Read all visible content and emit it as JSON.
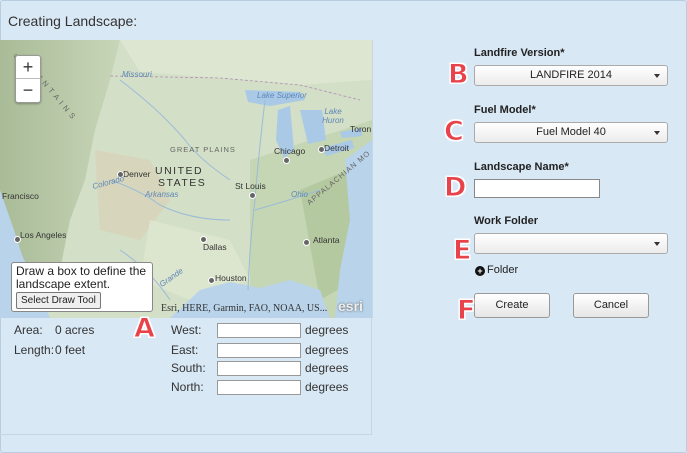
{
  "title": "Creating Landscape:",
  "map": {
    "zoom_in": "+",
    "zoom_out": "−",
    "labels": {
      "mountains": "M O U N T A I N S",
      "missouri": "Missouri",
      "lake_superior": "Lake Superior",
      "lake_huron": "Lake Huron",
      "toronto": "Toron",
      "great_plains": "GREAT PLAINS",
      "chicago": "Chicago",
      "detroit": "Detroit",
      "united": "UNITED",
      "states": "STATES",
      "denver": "Denver",
      "colorado": "Colorado",
      "arkansas": "Arkansas",
      "st_louis": "St Louis",
      "ohio": "Ohio",
      "appalachian": "APPALACHIAN MO",
      "francisco": "Francisco",
      "los_angeles": "Los Angeles",
      "dallas": "Dallas",
      "atlanta": "Atlanta",
      "houston": "Houston",
      "grande": "Grande",
      "nebraska_frag": "S"
    },
    "draw_instructions": "Draw a box to define the landscape extent.",
    "draw_button": "Select Draw Tool",
    "attribution": "Esri, HERE, Garmin, FAO, NOAA, US...",
    "logo": "esri"
  },
  "stats": {
    "area_label": "Area:",
    "area_value": "0 acres",
    "length_label": "Length:",
    "length_value": "0 feet"
  },
  "coords": {
    "west": "West:",
    "east": "East:",
    "south": "South:",
    "north": "North:",
    "unit": "degrees"
  },
  "form": {
    "landfire_label": "Landfire Version*",
    "landfire_value": "LANDFIRE 2014",
    "fuel_label": "Fuel Model*",
    "fuel_value": "Fuel Model 40",
    "name_label": "Landscape Name*",
    "name_value": "",
    "folder_label": "Work Folder",
    "folder_value": "",
    "add_folder": "Folder",
    "create": "Create",
    "cancel": "Cancel"
  },
  "markers": [
    "A",
    "B",
    "C",
    "D",
    "E",
    "F"
  ]
}
